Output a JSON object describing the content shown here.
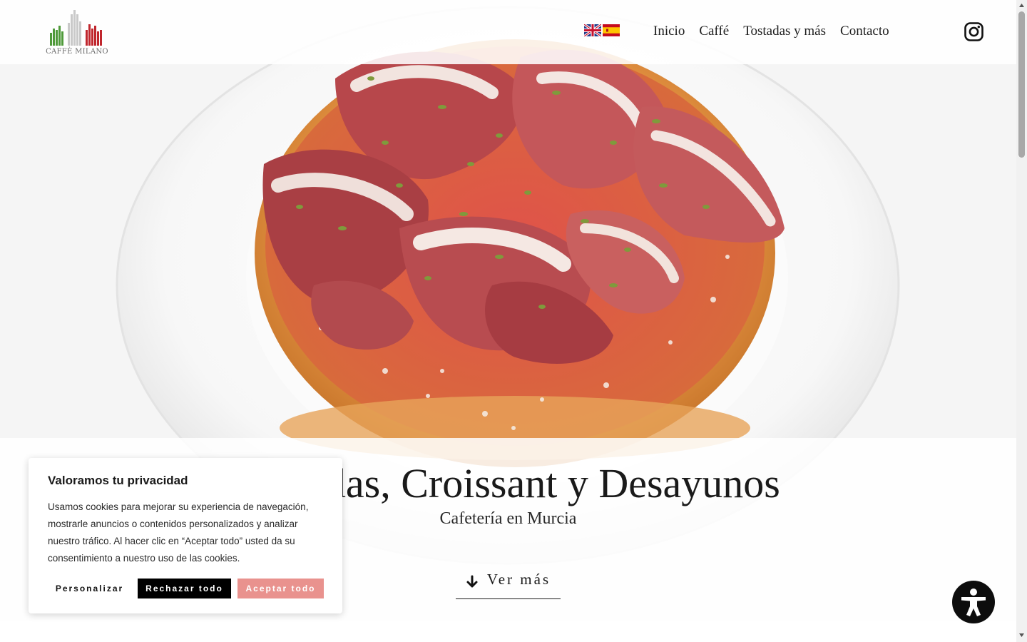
{
  "brand": {
    "logo_text": "CAFFÈ MILANO",
    "colors": {
      "green": "#4f9a3a",
      "red": "#c0262d",
      "grey": "#bdbdbd"
    }
  },
  "header": {
    "languages": [
      {
        "icon": "uk-flag-icon"
      },
      {
        "icon": "spain-flag-icon"
      }
    ],
    "nav": [
      {
        "label": "Inicio"
      },
      {
        "label": "Caffé"
      },
      {
        "label": "Tostadas y más"
      },
      {
        "label": "Contacto"
      }
    ],
    "social_icon": "instagram-icon"
  },
  "hero": {
    "title": "Tostadas, Croissant y Desayunos",
    "subtitle": "Cafetería en Murcia",
    "cta_label": "Ver más",
    "cta_icon": "arrow-down-icon"
  },
  "cookie_banner": {
    "title": "Valoramos tu privacidad",
    "text": "Usamos cookies para mejorar su experiencia de navegación, mostrarle anuncios o contenidos personalizados y analizar nuestro tráfico. Al hacer clic en “Aceptar todo” usted da su consentimiento a nuestro uso de las cookies.",
    "customize_label": "Personalizar",
    "reject_label": "Rechazar todo",
    "accept_label": "Aceptar todo",
    "colors": {
      "reject": "#000000",
      "accept": "#e9928e"
    }
  },
  "accessibility": {
    "icon": "accessibility-icon"
  }
}
